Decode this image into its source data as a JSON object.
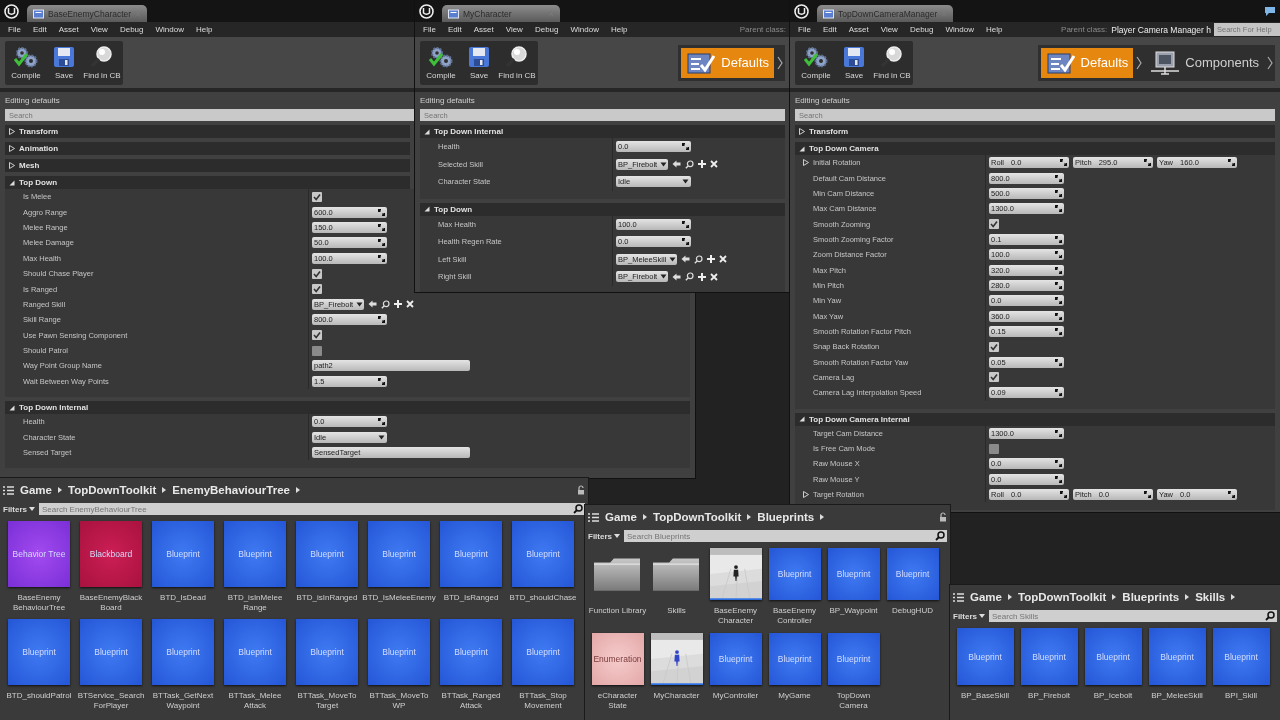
{
  "editors": [
    {
      "tab": "BaseEnemyCharacter",
      "menu": [
        "File",
        "Edit",
        "Asset",
        "View",
        "Debug",
        "Window",
        "Help"
      ],
      "toolbar": [
        {
          "kind": "compile",
          "label": "Compile"
        },
        {
          "kind": "save",
          "label": "Save"
        },
        {
          "kind": "find",
          "label": "Find in CB"
        }
      ],
      "panel_title": "Editing defaults",
      "search": {
        "placeholder": "Search"
      },
      "sections": [
        {
          "title": "Transform",
          "expanded": false
        },
        {
          "title": "Animation",
          "expanded": false
        },
        {
          "title": "Mesh",
          "expanded": false
        },
        {
          "title": "Top Down",
          "expanded": true,
          "rows": [
            {
              "label": "Is Melee",
              "kind": "check",
              "checked": true
            },
            {
              "label": "Aggro Range",
              "kind": "number",
              "value": "600.0"
            },
            {
              "label": "Melee Range",
              "kind": "number",
              "value": "150.0"
            },
            {
              "label": "Melee Damage",
              "kind": "number",
              "value": "50.0"
            },
            {
              "label": "Max Health",
              "kind": "number",
              "value": "100.0"
            },
            {
              "label": "Should Chase Player",
              "kind": "check",
              "checked": true
            },
            {
              "label": "Is Ranged",
              "kind": "check",
              "checked": true
            },
            {
              "label": "Ranged Skill",
              "kind": "asset",
              "value": "BP_Firebolt"
            },
            {
              "label": "Skill Range",
              "kind": "number",
              "value": "800.0"
            },
            {
              "label": "Use Pawn Sensing Component",
              "kind": "check",
              "checked": true
            },
            {
              "label": "Should Patrol",
              "kind": "check",
              "checked": false
            },
            {
              "label": "Way Point Group Name",
              "kind": "text",
              "value": "path2"
            },
            {
              "label": "Wait Between Way Points",
              "kind": "number",
              "value": "1.5"
            }
          ]
        },
        {
          "title": "Top Down Internal",
          "expanded": true,
          "rows": [
            {
              "label": "Health",
              "kind": "number",
              "value": "0.0"
            },
            {
              "label": "Character State",
              "kind": "dropdown",
              "value": "Idle"
            },
            {
              "label": "Sensed Target",
              "kind": "text",
              "value": "SensedTarget"
            }
          ]
        }
      ]
    },
    {
      "tab": "MyCharacter",
      "menu": [
        "File",
        "Edit",
        "Asset",
        "View",
        "Debug",
        "Window",
        "Help"
      ],
      "parent_class_label": "Parent class:",
      "toolbar": [
        {
          "kind": "compile",
          "label": "Compile"
        },
        {
          "kind": "save",
          "label": "Save"
        },
        {
          "kind": "find",
          "label": "Find in CB"
        }
      ],
      "modes": [
        {
          "kind": "defaults",
          "label": "Defaults",
          "selected": true
        }
      ],
      "panel_title": "Editing defaults",
      "search": {
        "placeholder": "Search"
      },
      "sections": [
        {
          "title": "Top Down Internal",
          "expanded": true,
          "rows": [
            {
              "label": "Health",
              "kind": "number",
              "value": "0.0"
            },
            {
              "label": "Selected Skill",
              "kind": "asset",
              "value": "BP_Firebolt"
            },
            {
              "label": "Character State",
              "kind": "dropdown",
              "value": "Idle"
            }
          ]
        },
        {
          "title": "Top Down",
          "expanded": true,
          "rows": [
            {
              "label": "Max Health",
              "kind": "number",
              "value": "100.0"
            },
            {
              "label": "Health Regen Rate",
              "kind": "number",
              "value": "0.0"
            },
            {
              "label": "Left Skill",
              "kind": "asset",
              "value": "BP_MeleeSkill"
            },
            {
              "label": "Right Skill",
              "kind": "asset",
              "value": "BP_Firebolt"
            }
          ]
        }
      ]
    },
    {
      "tab": "TopDownCameraManager",
      "menu": [
        "File",
        "Edit",
        "Asset",
        "View",
        "Debug",
        "Window",
        "Help"
      ],
      "parent_class_label": "Parent class:",
      "parent_class": "Player Camera Manager h",
      "help_search": {
        "placeholder": "Search For Help"
      },
      "toolbar": [
        {
          "kind": "compile",
          "label": "Compile"
        },
        {
          "kind": "save",
          "label": "Save"
        },
        {
          "kind": "find",
          "label": "Find in CB"
        }
      ],
      "modes": [
        {
          "kind": "defaults",
          "label": "Defaults",
          "selected": true
        },
        {
          "kind": "components",
          "label": "Components",
          "selected": false
        }
      ],
      "panel_title": "Editing defaults",
      "search": {
        "placeholder": "Search"
      },
      "sections": [
        {
          "title": "Transform",
          "expanded": false
        },
        {
          "title": "Top Down Camera",
          "expanded": true,
          "rows": [
            {
              "label": "Initial Rotation",
              "kind": "rotator",
              "components": [
                {
                  "axis": "Roll",
                  "value": "0.0"
                },
                {
                  "axis": "Pitch",
                  "value": "295.0"
                },
                {
                  "axis": "Yaw",
                  "value": "160.0"
                }
              ]
            },
            {
              "label": "Default Cam Distance",
              "kind": "number",
              "value": "800.0"
            },
            {
              "label": "Min Cam Distance",
              "kind": "number",
              "value": "500.0"
            },
            {
              "label": "Max Cam Distance",
              "kind": "number",
              "value": "1300.0"
            },
            {
              "label": "Smooth Zooming",
              "kind": "check",
              "checked": true
            },
            {
              "label": "Smooth Zooming Factor",
              "kind": "number",
              "value": "0.1"
            },
            {
              "label": "Zoom Distance Factor",
              "kind": "number",
              "value": "100.0"
            },
            {
              "label": "Max Pitch",
              "kind": "number",
              "value": "320.0"
            },
            {
              "label": "Min Pitch",
              "kind": "number",
              "value": "280.0"
            },
            {
              "label": "Min Yaw",
              "kind": "number",
              "value": "0.0"
            },
            {
              "label": "Max Yaw",
              "kind": "number",
              "value": "360.0"
            },
            {
              "label": "Smooth Rotation Factor Pitch",
              "kind": "number",
              "value": "0.15"
            },
            {
              "label": "Snap Back Rotation",
              "kind": "check",
              "checked": true
            },
            {
              "label": "Smooth Rotation Factor Yaw",
              "kind": "number",
              "value": "0.05"
            },
            {
              "label": "Camera Lag",
              "kind": "check",
              "checked": true
            },
            {
              "label": "Camera Lag Interpolation Speed",
              "kind": "number",
              "value": "0.09"
            }
          ]
        },
        {
          "title": "Top Down Camera Internal",
          "expanded": true,
          "rows": [
            {
              "label": "Target Cam Distance",
              "kind": "number",
              "value": "1300.0"
            },
            {
              "label": "Is Free Cam Mode",
              "kind": "check",
              "checked": false
            },
            {
              "label": "Raw Mouse X",
              "kind": "number",
              "value": "0.0"
            },
            {
              "label": "Raw Mouse Y",
              "kind": "number",
              "value": "0.0"
            },
            {
              "label": "Target Rotation",
              "kind": "rotator",
              "components": [
                {
                  "axis": "Roll",
                  "value": "0.0"
                },
                {
                  "axis": "Pitch",
                  "value": "0.0"
                },
                {
                  "axis": "Yaw",
                  "value": "0.0"
                }
              ]
            }
          ]
        }
      ]
    }
  ],
  "browsers": [
    {
      "path": [
        "Game",
        "TopDownToolkit",
        "EnemyBehaviourTree"
      ],
      "filters": "Filters",
      "search": {
        "placeholder": "Search EnemyBehaviourTree"
      },
      "items": [
        {
          "kind": "behavior-tree",
          "thumb": "Behavior Tree",
          "name": "BaseEnemy BehaviourTree"
        },
        {
          "kind": "blackboard",
          "thumb": "Blackboard",
          "name": "BaseEnemyBlack Board"
        },
        {
          "kind": "blueprint",
          "thumb": "Blueprint",
          "name": "BTD_IsDead"
        },
        {
          "kind": "blueprint",
          "thumb": "Blueprint",
          "name": "BTD_isInMelee Range"
        },
        {
          "kind": "blueprint",
          "thumb": "Blueprint",
          "name": "BTD_isInRanged"
        },
        {
          "kind": "blueprint",
          "thumb": "Blueprint",
          "name": "BTD_IsMeleeEnemy"
        },
        {
          "kind": "blueprint",
          "thumb": "Blueprint",
          "name": "BTD_IsRanged"
        },
        {
          "kind": "blueprint",
          "thumb": "Blueprint",
          "name": "BTD_shouldChase"
        },
        {
          "kind": "blueprint",
          "thumb": "Blueprint",
          "name": "BTD_shouldPatrol"
        },
        {
          "kind": "blueprint",
          "thumb": "Blueprint",
          "name": "BTService_Search ForPlayer"
        },
        {
          "kind": "blueprint",
          "thumb": "Blueprint",
          "name": "BTTask_GetNext Waypoint"
        },
        {
          "kind": "blueprint",
          "thumb": "Blueprint",
          "name": "BTTask_Melee Attack"
        },
        {
          "kind": "blueprint",
          "thumb": "Blueprint",
          "name": "BTTask_MoveTo Target"
        },
        {
          "kind": "blueprint",
          "thumb": "Blueprint",
          "name": "BTTask_MoveTo WP"
        },
        {
          "kind": "blueprint",
          "thumb": "Blueprint",
          "name": "BTTask_Ranged Attack"
        },
        {
          "kind": "blueprint",
          "thumb": "Blueprint",
          "name": "BTTask_Stop Movement"
        }
      ]
    },
    {
      "path": [
        "Game",
        "TopDownToolkit",
        "Blueprints"
      ],
      "filters": "Filters",
      "search": {
        "placeholder": "Search Blueprints"
      },
      "items": [
        {
          "kind": "folder",
          "name": "Function Library"
        },
        {
          "kind": "folder",
          "name": "Skills"
        },
        {
          "kind": "picture",
          "name": "BaseEnemy Character"
        },
        {
          "kind": "blueprint",
          "thumb": "Blueprint",
          "name": "BaseEnemy Controller"
        },
        {
          "kind": "blueprint",
          "thumb": "Blueprint",
          "name": "BP_Waypoint"
        },
        {
          "kind": "blueprint",
          "thumb": "Blueprint",
          "name": "DebugHUD"
        },
        {
          "kind": "enumeration",
          "thumb": "Enumeration",
          "name": "eCharacter State"
        },
        {
          "kind": "picture",
          "name": "MyCharacter"
        },
        {
          "kind": "blueprint",
          "thumb": "Blueprint",
          "name": "MyController"
        },
        {
          "kind": "blueprint",
          "thumb": "Blueprint",
          "name": "MyGame"
        },
        {
          "kind": "blueprint",
          "thumb": "Blueprint",
          "name": "TopDown Camera"
        }
      ]
    },
    {
      "path": [
        "Game",
        "TopDownToolkit",
        "Blueprints",
        "Skills"
      ],
      "filters": "Filters",
      "search": {
        "placeholder": "Search Skills"
      },
      "items": [
        {
          "kind": "blueprint",
          "thumb": "Blueprint",
          "name": "BP_BaseSkill"
        },
        {
          "kind": "blueprint",
          "thumb": "Blueprint",
          "name": "BP_Firebolt"
        },
        {
          "kind": "blueprint",
          "thumb": "Blueprint",
          "name": "BP_Icebolt"
        },
        {
          "kind": "blueprint",
          "thumb": "Blueprint",
          "name": "BP_MeleeSkill"
        },
        {
          "kind": "blueprint",
          "thumb": "Blueprint",
          "name": "BPI_Skill"
        }
      ]
    }
  ]
}
